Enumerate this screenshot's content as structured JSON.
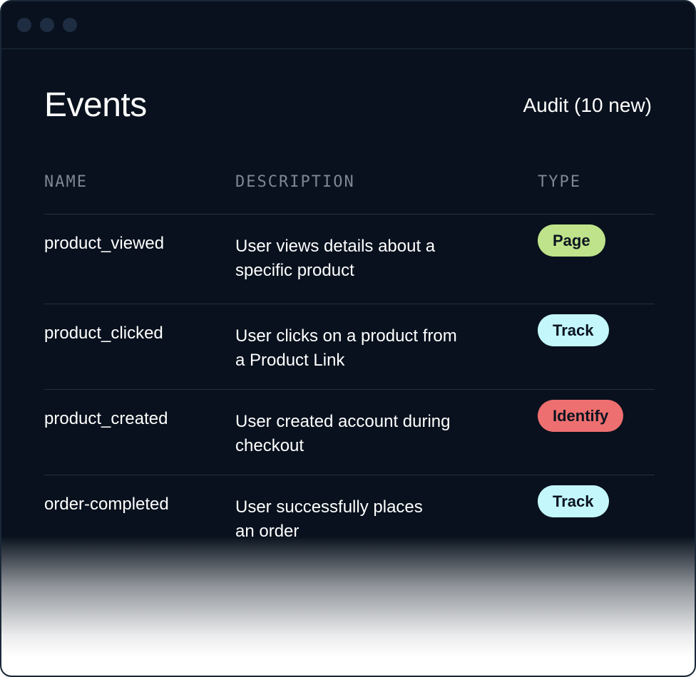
{
  "header": {
    "title": "Events",
    "audit_label": "Audit (10 new)"
  },
  "columns": {
    "name": "NAME",
    "description": "DESCRIPTION",
    "type": "TYPE"
  },
  "rows": [
    {
      "name": "product_viewed",
      "description_lines": [
        "User views details about a",
        "specific product"
      ],
      "type": "Page",
      "type_color": "#bfe38a"
    },
    {
      "name": "product_clicked",
      "description_lines": [
        "User clicks on a product from",
        "a Product Link"
      ],
      "type": "Track",
      "type_color": "#c4f7fb"
    },
    {
      "name": "product_created",
      "description_lines": [
        "User created account during",
        "checkout"
      ],
      "type": "Identify",
      "type_color": "#ee6f70"
    },
    {
      "name": "order-completed",
      "description_lines": [
        "User successfully places",
        "an order"
      ],
      "type": "Track",
      "type_color": "#c4f7fb"
    }
  ],
  "colors": {
    "background": "#08111d",
    "header_text": "#7e8793",
    "divider": "#26323f"
  }
}
